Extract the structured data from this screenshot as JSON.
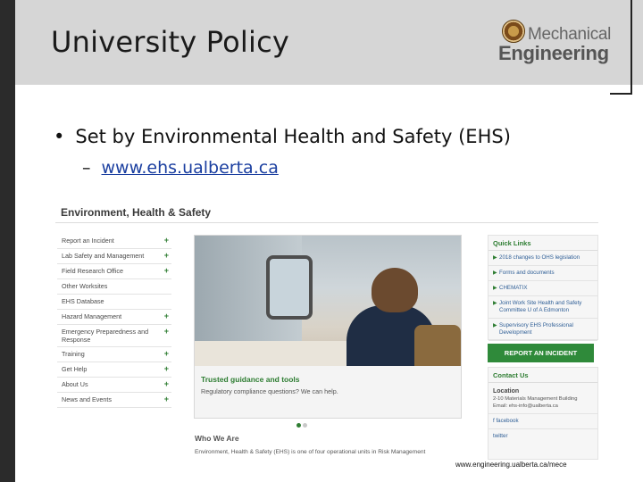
{
  "slide": {
    "title": "University Policy",
    "logo": {
      "line1": "Mechanical",
      "line2": "Engineering"
    },
    "bullet": {
      "text": "Set by Environmental Health and Safety (EHS)",
      "marker": "•"
    },
    "sub_bullet": {
      "marker": "–",
      "link": "www.ehs.ualberta.ca"
    },
    "footer_url": "www.engineering.ualberta.ca/mece"
  },
  "site": {
    "title": "Environment, Health & Safety",
    "nav": [
      {
        "label": "Report an Incident",
        "expand": "+"
      },
      {
        "label": "Lab Safety and Management",
        "expand": "+"
      },
      {
        "label": "Field Research Office",
        "expand": "+"
      },
      {
        "label": "Other Worksites",
        "expand": ""
      },
      {
        "label": "EHS Database",
        "expand": ""
      },
      {
        "label": "Hazard Management",
        "expand": "+"
      },
      {
        "label": "Emergency Preparedness and Response",
        "expand": "+"
      },
      {
        "label": "Training",
        "expand": "+"
      },
      {
        "label": "Get Help",
        "expand": "+"
      },
      {
        "label": "About Us",
        "expand": "+"
      },
      {
        "label": "News and Events",
        "expand": "+"
      }
    ],
    "hero": {
      "heading": "Trusted guidance and tools",
      "subtext": "Regulatory compliance questions? We can help."
    },
    "who": {
      "title": "Who We Are",
      "text": "Environment, Health & Safety (EHS) is one of four operational units in Risk Management"
    },
    "quick_links": {
      "title": "Quick Links",
      "arrow": "▶",
      "items": [
        "2018 changes to OHS legislation",
        "Forms and documents",
        "CHEMATIX",
        "Joint Work Site Health and Safety Committee U of A Edmonton",
        "Supervisory EHS Professional Development"
      ]
    },
    "report_button": "REPORT AN INCIDENT",
    "contact": {
      "title": "Contact Us",
      "location_label": "Location",
      "location_value": "2-10 Materials Management Building",
      "email": "Email: ehs-info@ualberta.ca",
      "facebook": "f facebook",
      "twitter": "twitter"
    },
    "colors": {
      "accent_green": "#2e7d32",
      "button_green": "#2f8a3a",
      "link_blue": "#2e5e96"
    }
  }
}
